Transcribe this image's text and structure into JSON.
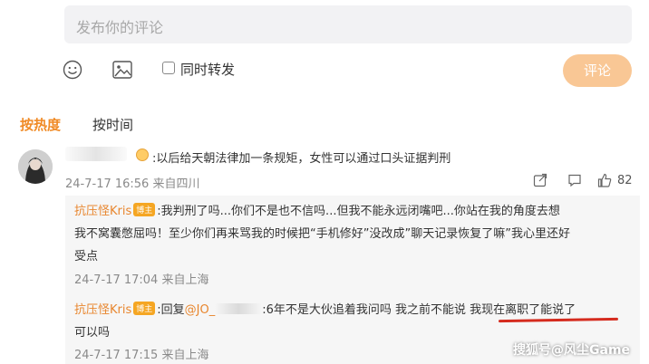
{
  "composer": {
    "placeholder": "发布你的评论",
    "repost_label": "同时转发",
    "submit_label": "评论"
  },
  "sort": {
    "hot": "按热度",
    "time": "按时间"
  },
  "main_comment": {
    "text": ":以后给天朝法律加一条规矩，女性可以通过口头证据判刑",
    "meta": "24-7-17 16:56 来自四川",
    "likes": "82"
  },
  "replies": [
    {
      "author": "抗压怪Kris",
      "badge": "博主",
      "lines": [
        ":我判刑了吗...你们不是也不信吗...但我不能永远闭嘴吧...你站在我的角度去想",
        "我不窝囊憋屈吗！至少你们再来骂我的时候把“手机修好”没改成”聊天记录恢复了嘛”我心里还好",
        "受点"
      ],
      "meta": "24-7-17 17:04 来自上海"
    },
    {
      "author": "抗压怪Kris",
      "badge": "博主",
      "prefix": ":回复",
      "mention": "@JO_",
      "text_after": ":6年不是大伙追着我问吗 我之前不能说 我现在离职了能说了",
      "line2": "可以吗",
      "meta": "24-7-17 17:15 来自上海"
    }
  ],
  "watermark": "搜狐号@风尘Game"
}
